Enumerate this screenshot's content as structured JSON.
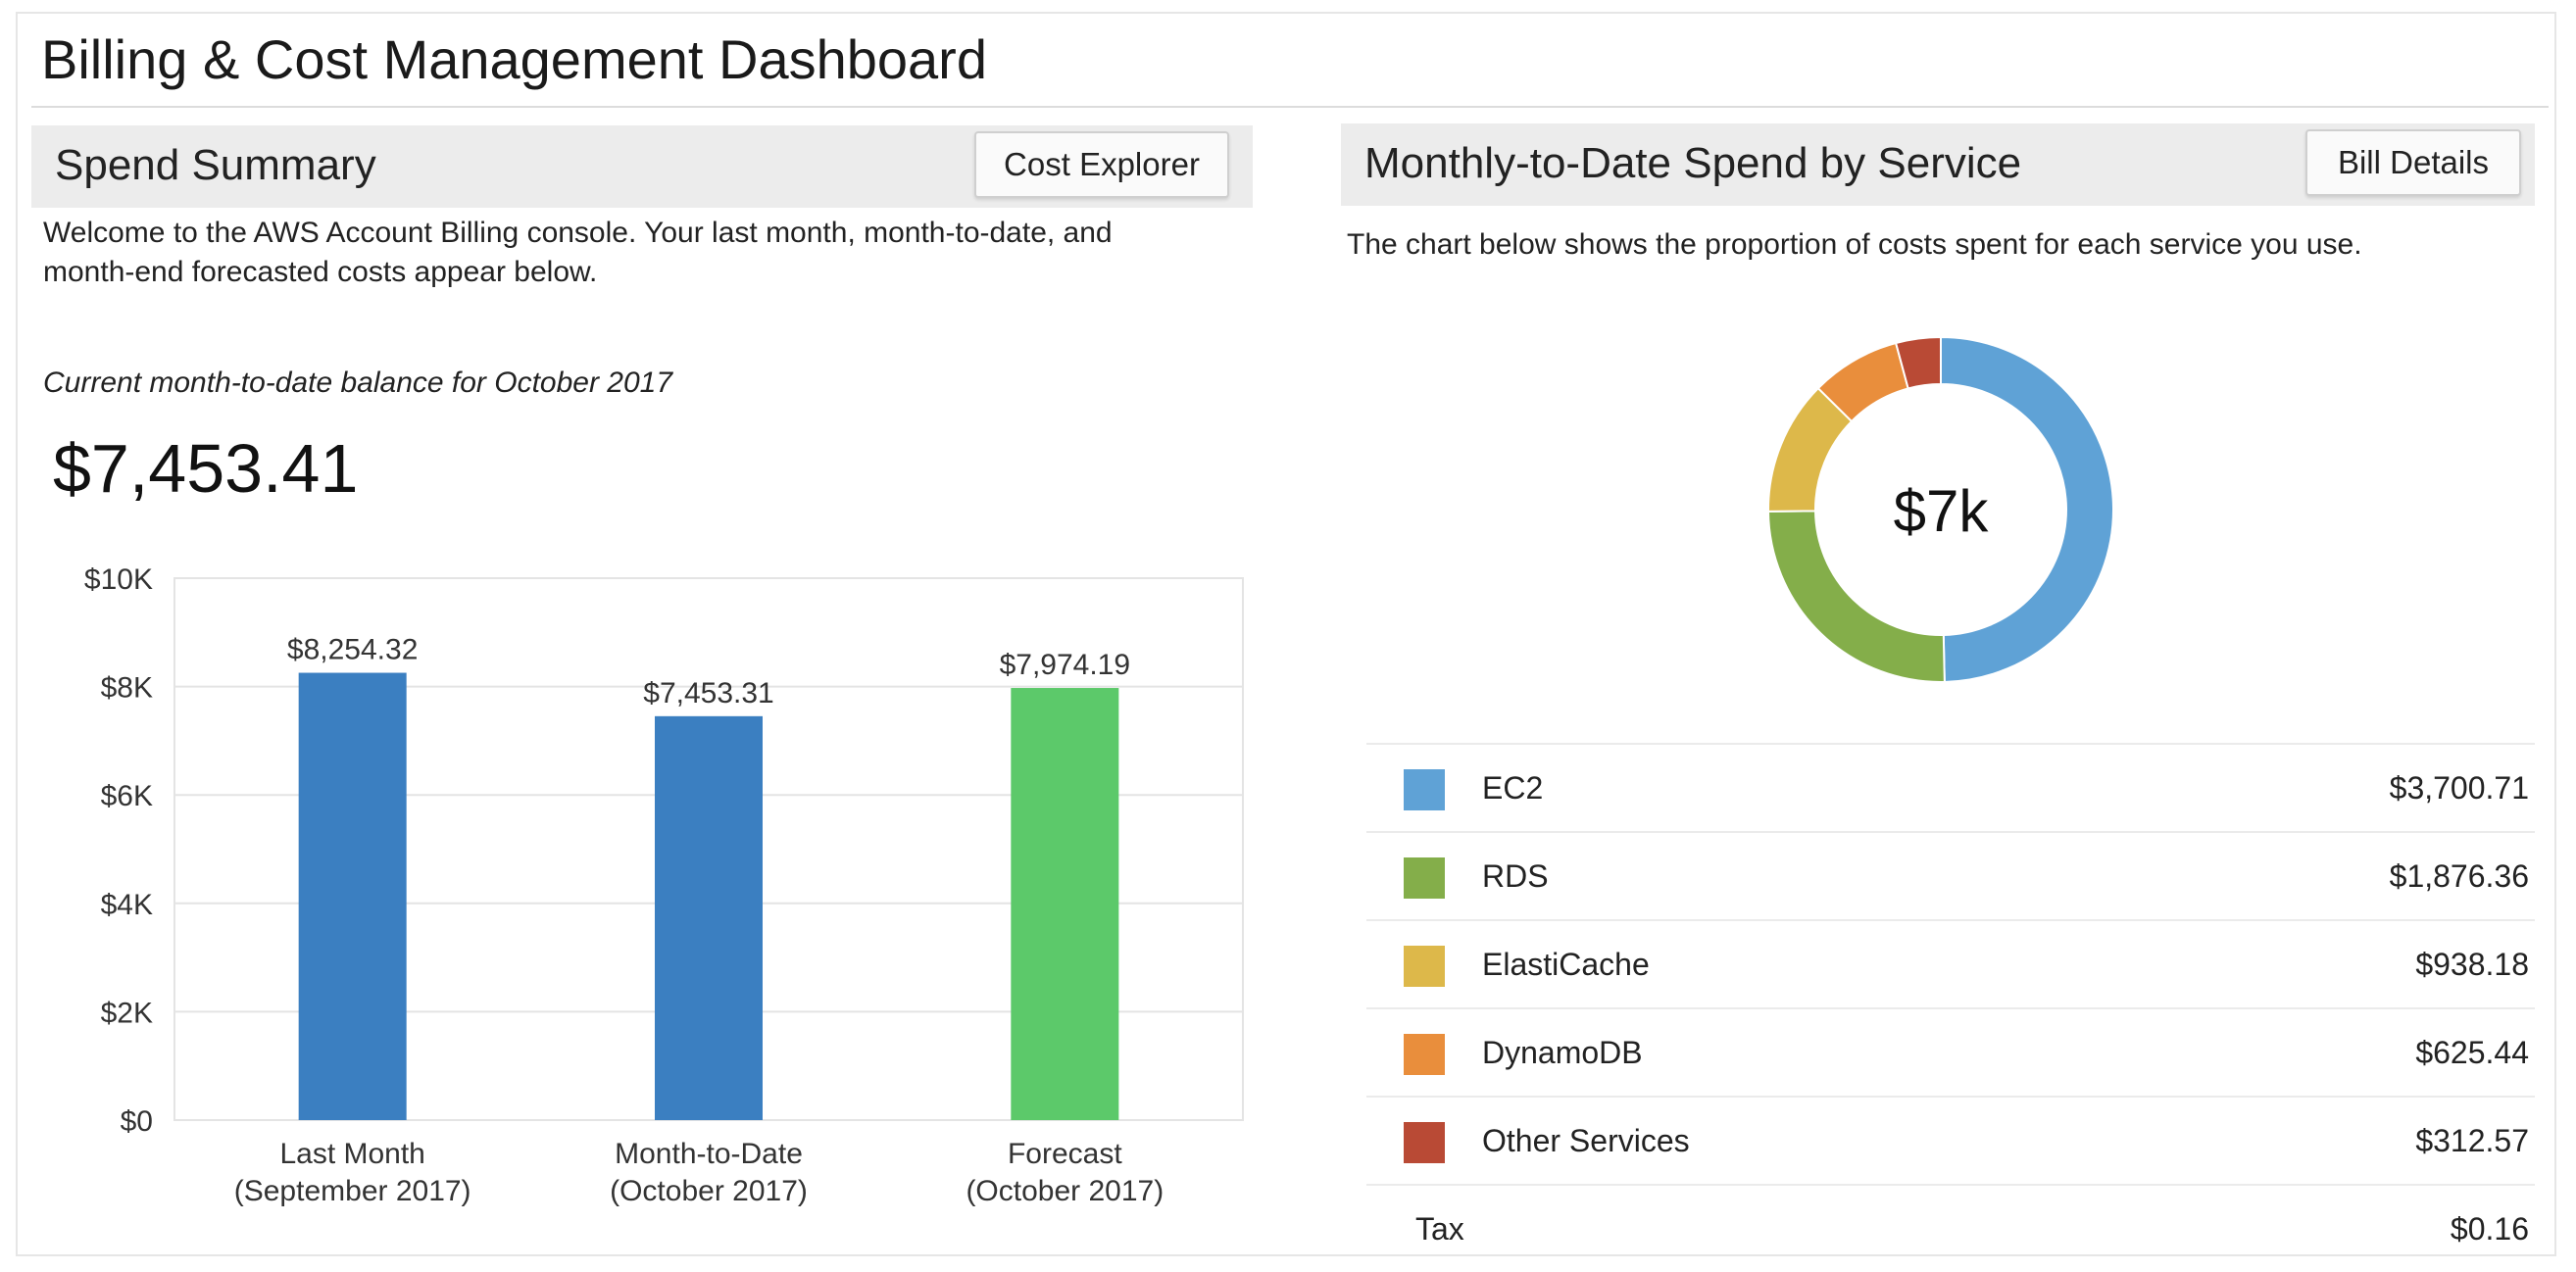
{
  "page": {
    "title": "Billing & Cost Management Dashboard"
  },
  "spend_summary": {
    "heading": "Spend Summary",
    "button_label": "Cost Explorer",
    "intro": "Welcome to the AWS Account Billing console. Your last month, month-to-date, and month-end forecasted costs appear below.",
    "balance_caption": "Current month-to-date balance for October 2017",
    "balance": "$7,453.41"
  },
  "service_panel": {
    "heading": "Monthly-to-Date Spend by Service",
    "button_label": "Bill Details",
    "intro": "The chart below shows the proportion of costs spent for each service you use.",
    "donut_center": "$7k",
    "services": [
      {
        "name": "EC2",
        "amount": "$3,700.71",
        "color": "#5fa2d6"
      },
      {
        "name": "RDS",
        "amount": "$1,876.36",
        "color": "#84ae4a"
      },
      {
        "name": "ElastiCache",
        "amount": "$938.18",
        "color": "#ddb84a"
      },
      {
        "name": "DynamoDB",
        "amount": "$625.44",
        "color": "#e98e3c"
      },
      {
        "name": "Other Services",
        "amount": "$312.57",
        "color": "#b94a35"
      }
    ],
    "tax": {
      "name": "Tax",
      "amount": "$0.16"
    }
  },
  "chart_data": [
    {
      "type": "bar",
      "categories": [
        [
          "Last Month",
          "(September 2017)"
        ],
        [
          "Month-to-Date",
          "(October 2017)"
        ],
        [
          "Forecast",
          "(October 2017)"
        ]
      ],
      "values": [
        8254.32,
        7453.31,
        7974.19
      ],
      "value_labels": [
        "$8,254.32",
        "$7,453.31",
        "$7,974.19"
      ],
      "colors": [
        "#3b7fc1",
        "#3b7fc1",
        "#5cc96a"
      ],
      "ylim": [
        0,
        10000
      ],
      "yticks": [
        0,
        2000,
        4000,
        6000,
        8000,
        10000
      ],
      "ytick_labels": [
        "$0",
        "$2K",
        "$4K",
        "$6K",
        "$8K",
        "$10K"
      ],
      "grid": true
    },
    {
      "type": "pie",
      "labels": [
        "EC2",
        "RDS",
        "ElastiCache",
        "DynamoDB",
        "Other Services"
      ],
      "values": [
        3700.71,
        1876.36,
        938.18,
        625.44,
        312.57
      ],
      "colors": [
        "#5fa2d6",
        "#84ae4a",
        "#ddb84a",
        "#e98e3c",
        "#b94a35"
      ],
      "center_label": "$7k"
    }
  ]
}
